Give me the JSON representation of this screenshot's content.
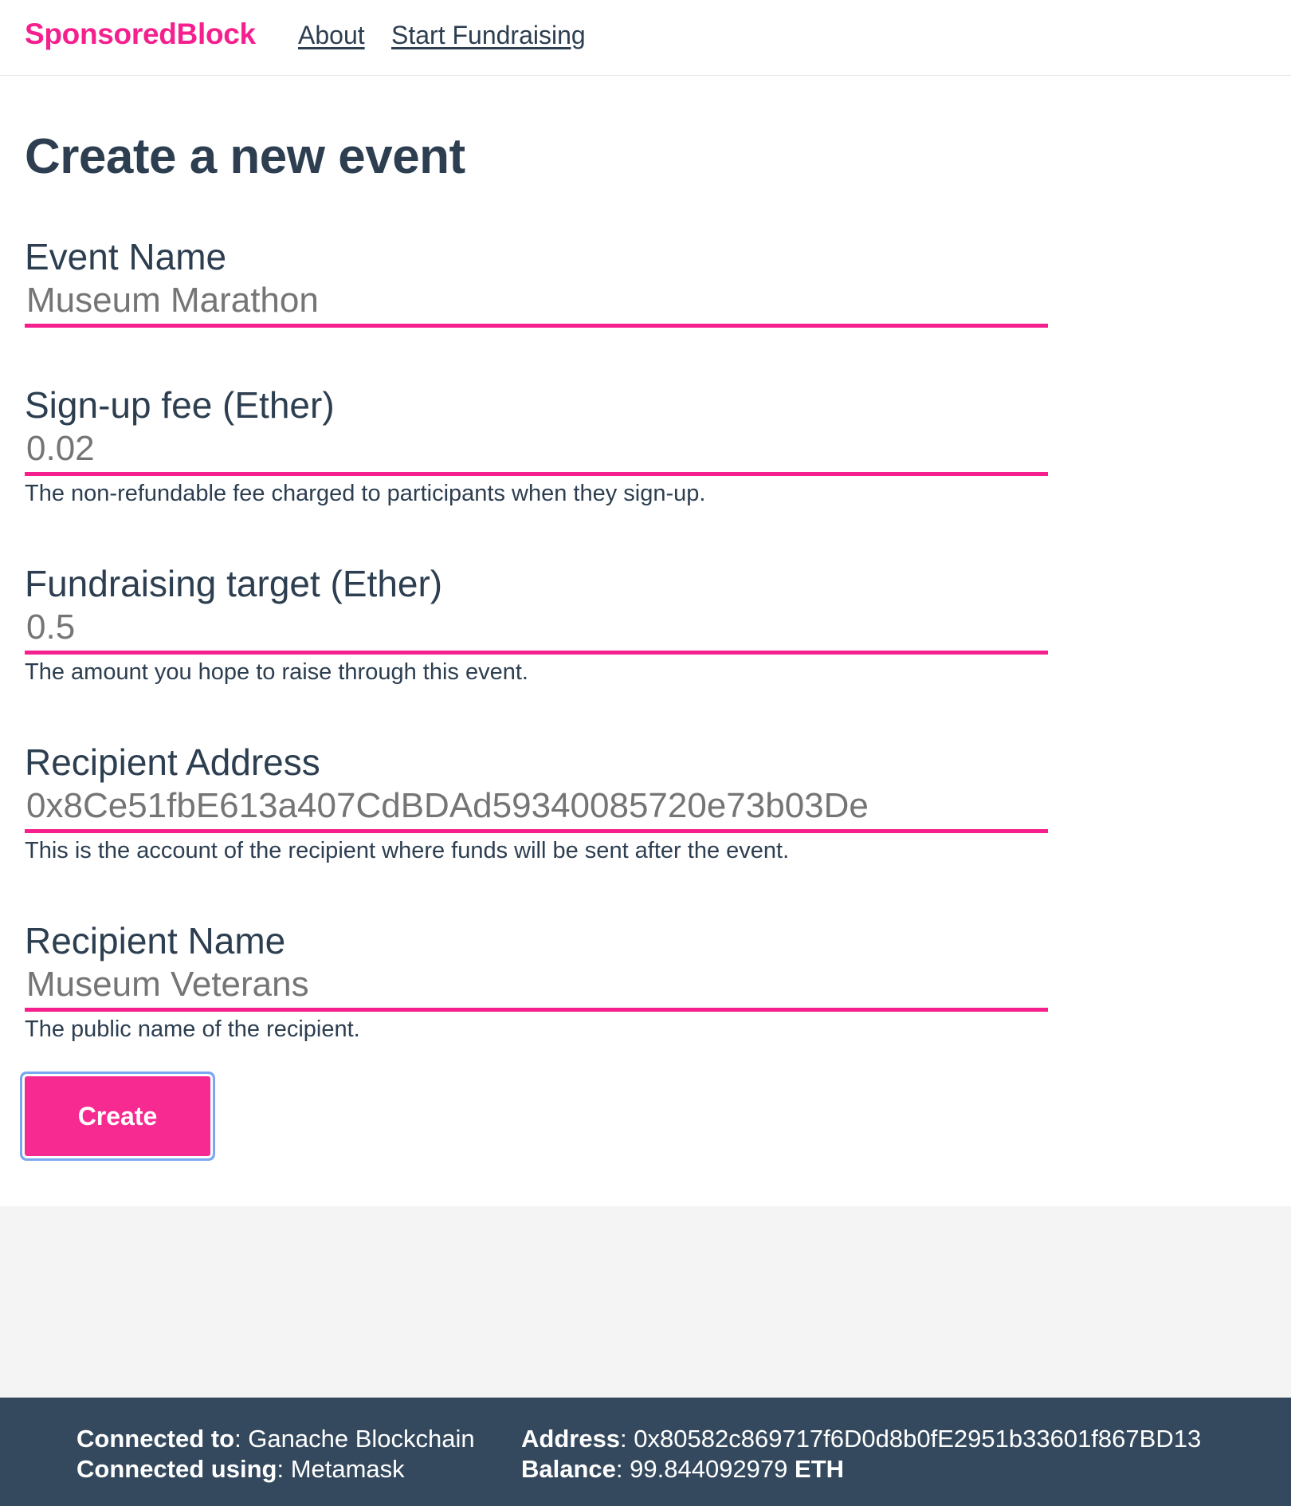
{
  "header": {
    "brand": "SponsoredBlock",
    "nav": [
      {
        "label": "About"
      },
      {
        "label": "Start Fundraising"
      }
    ]
  },
  "main": {
    "title": "Create a new event",
    "fields": [
      {
        "label": "Event Name",
        "placeholder": "Museum Marathon",
        "help": ""
      },
      {
        "label": "Sign-up fee (Ether)",
        "placeholder": "0.02",
        "help": "The non-refundable fee charged to participants when they sign-up."
      },
      {
        "label": "Fundraising target (Ether)",
        "placeholder": "0.5",
        "help": "The amount you hope to raise through this event."
      },
      {
        "label": "Recipient Address",
        "placeholder": "0x8Ce51fbE613a407CdBDAd59340085720e73b03De",
        "help": "This is the account of the recipient where funds will be sent after the event."
      },
      {
        "label": "Recipient Name",
        "placeholder": "Museum Veterans",
        "help": "The public name of the recipient."
      }
    ],
    "submit_label": "Create"
  },
  "footer": {
    "connected_to_key": "Connected to",
    "connected_to_value": "Ganache Blockchain",
    "connected_using_key": "Connected using",
    "connected_using_value": "Metamask",
    "address_key": "Address",
    "address_value": "0x80582c869717f6D0d8b0fE2951b33601f867BD13",
    "balance_key": "Balance",
    "balance_value": "99.844092979",
    "balance_unit": "ETH"
  },
  "colors": {
    "accent": "#f5208e",
    "text": "#2c3e50",
    "footer_bg": "#34495e"
  }
}
